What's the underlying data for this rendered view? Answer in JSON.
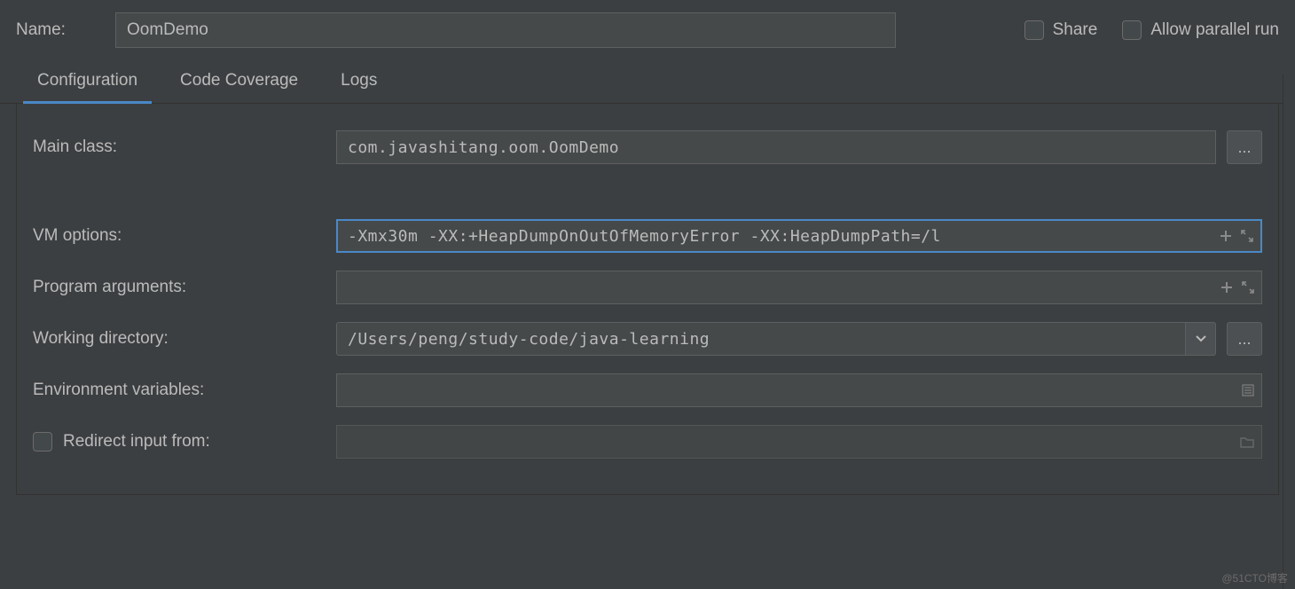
{
  "header": {
    "name_label": "Name:",
    "name_value": "OomDemo",
    "share_label": "Share",
    "allow_parallel_label": "Allow parallel run"
  },
  "tabs": [
    {
      "label": "Configuration",
      "active": true
    },
    {
      "label": "Code Coverage",
      "active": false
    },
    {
      "label": "Logs",
      "active": false
    }
  ],
  "form": {
    "main_class": {
      "label": "Main class:",
      "value": "com.javashitang.oom.OomDemo"
    },
    "vm_options": {
      "label": "VM options:",
      "value": "-Xmx30m -XX:+HeapDumpOnOutOfMemoryError -XX:HeapDumpPath=/l"
    },
    "program_args": {
      "label": "Program arguments:",
      "value": ""
    },
    "working_dir": {
      "label": "Working directory:",
      "value": "/Users/peng/study-code/java-learning"
    },
    "env_vars": {
      "label": "Environment variables:",
      "value": ""
    },
    "redirect_input": {
      "label": "Redirect input from:",
      "value": ""
    }
  },
  "watermark": "@51CTO博客"
}
